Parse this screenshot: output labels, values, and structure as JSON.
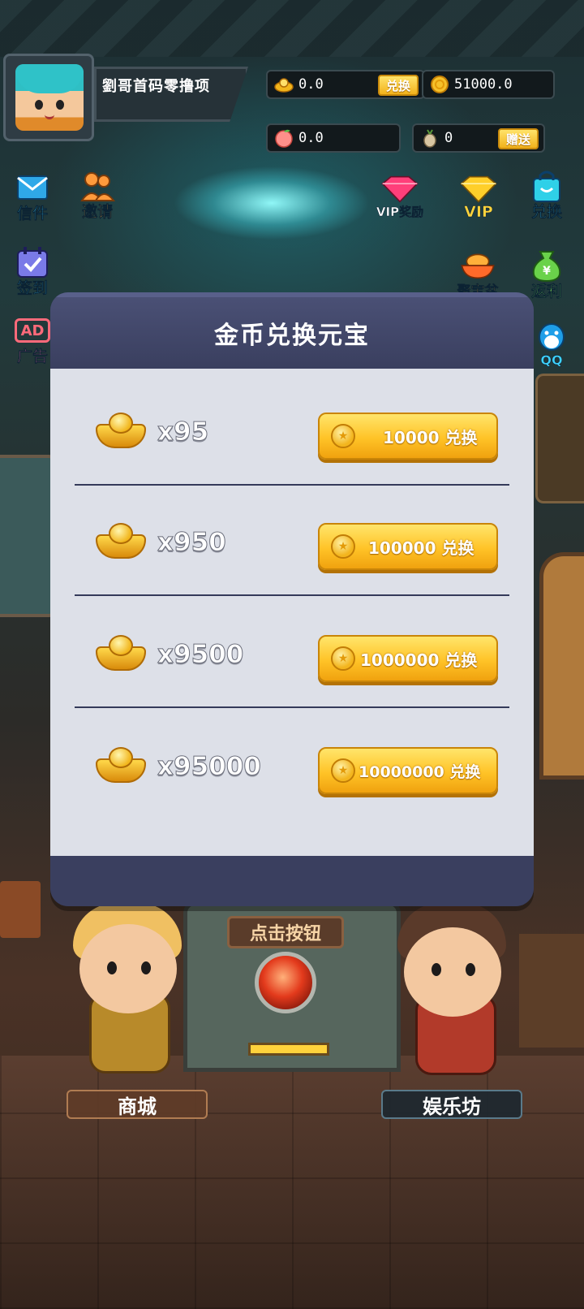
{
  "header": {
    "player_name": "劉哥首码零撸项",
    "yuanbao_value": "0.0",
    "exchange_label": "兑换",
    "gold_value": "51000.0",
    "peach_value": "0.0",
    "item_value": "0",
    "gift_label": "赠送"
  },
  "side_icons": {
    "mail": "信件",
    "invite": "邀请",
    "vip_reward": "VIP奖励",
    "vip": "VIP",
    "exchange": "兑换",
    "checkin": "签到",
    "treasure": "聚宝盆",
    "rebate": "返利",
    "ad_badge": "AD",
    "ad": "广告",
    "qq": "QQ"
  },
  "modal": {
    "title": "金币兑换元宝",
    "rows": [
      {
        "quantity": "x95",
        "button": "10000 兑换"
      },
      {
        "quantity": "x950",
        "button": "100000 兑换"
      },
      {
        "quantity": "x9500",
        "button": "1000000 兑换"
      },
      {
        "quantity": "x95000",
        "button": "10000000 兑换"
      }
    ]
  },
  "bottom": {
    "click_sign": "点击按钮",
    "shop": "商城",
    "entertainment": "娱乐坊"
  },
  "icons": {
    "yuanbao": "yuanbao-icon",
    "gold": "gold-coin-icon",
    "peach": "peach-icon",
    "item": "seed-icon"
  }
}
